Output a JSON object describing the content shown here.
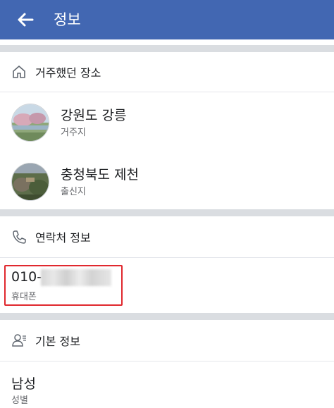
{
  "header": {
    "title": "정보"
  },
  "places_section": {
    "heading": "거주했던 장소",
    "items": [
      {
        "name": "강원도 강릉",
        "type": "거주지"
      },
      {
        "name": "충청북도 제천",
        "type": "출신지"
      }
    ]
  },
  "contact_section": {
    "heading": "연락처 정보",
    "phone_visible_prefix": "010-",
    "phone_type": "휴대폰"
  },
  "basic_section": {
    "heading": "기본 정보",
    "gender_value": "남성",
    "gender_label": "성별"
  },
  "colors": {
    "appbar": "#4267b2",
    "highlight": "#e0282e",
    "divider": "#dadde1"
  }
}
